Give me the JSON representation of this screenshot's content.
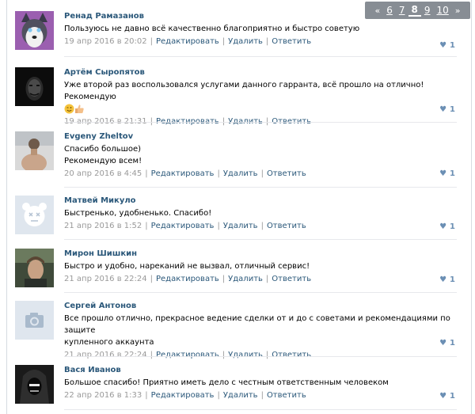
{
  "pagination": {
    "prev": "«",
    "pages": [
      "6",
      "7",
      "8",
      "9",
      "10"
    ],
    "current": "8",
    "next": "»"
  },
  "actions": {
    "edit": "Редактировать",
    "delete": "Удалить",
    "reply": "Ответить"
  },
  "comments": [
    {
      "author": "Ренад Рамазанов",
      "lines": [
        "Пользуюсь не давно всё качественно благоприятно и быстро советую"
      ],
      "date": "19 апр 2016 в 20:02",
      "likes": "1",
      "avatar": "husky-avatar"
    },
    {
      "author": "Артём Сыропятов",
      "lines": [
        "Уже второй раз воспользовался услугами данного гарранта, всё прошло на отлично! Рекомендую"
      ],
      "date": "19 апр 2016 в 21:31",
      "likes": "1",
      "avatar": "mask-avatar",
      "emoji": [
        "wink-emoji",
        "thumbs-up-emoji"
      ]
    },
    {
      "author": "Evgeny Zheltov",
      "lines": [
        "Спасибо большое)",
        "Рекомендую всем!"
      ],
      "date": "20 апр 2016 в 4:45",
      "likes": "1",
      "avatar": "photo-avatar"
    },
    {
      "author": "Матвей Микуло",
      "lines": [
        "Быстренько, удобненько. Спасибо!"
      ],
      "date": "21 апр 2016 в 1:52",
      "likes": "1",
      "avatar": "deactivated-avatar"
    },
    {
      "author": "Мирон Шишкин",
      "lines": [
        "Быстро и удобно, нареканий не вызвал, отличный сервис!"
      ],
      "date": "21 апр 2016 в 22:24",
      "likes": "1",
      "avatar": "movie-avatar"
    },
    {
      "author": "Сергей Антонов",
      "lines": [
        "Все прошло отлично, прекрасное ведение сделки от и до с советами и рекомендациями по защите",
        "купленного аккаунта"
      ],
      "date": "21 апр 2016 в 22:24",
      "likes": "1",
      "avatar": "camera-avatar"
    },
    {
      "author": "Вася Иванов",
      "lines": [
        "Большое спасибо! Приятно иметь дело с честным ответственным человеком"
      ],
      "date": "22 апр 2016 в 1:33",
      "likes": "1",
      "avatar": "hood-avatar"
    }
  ]
}
